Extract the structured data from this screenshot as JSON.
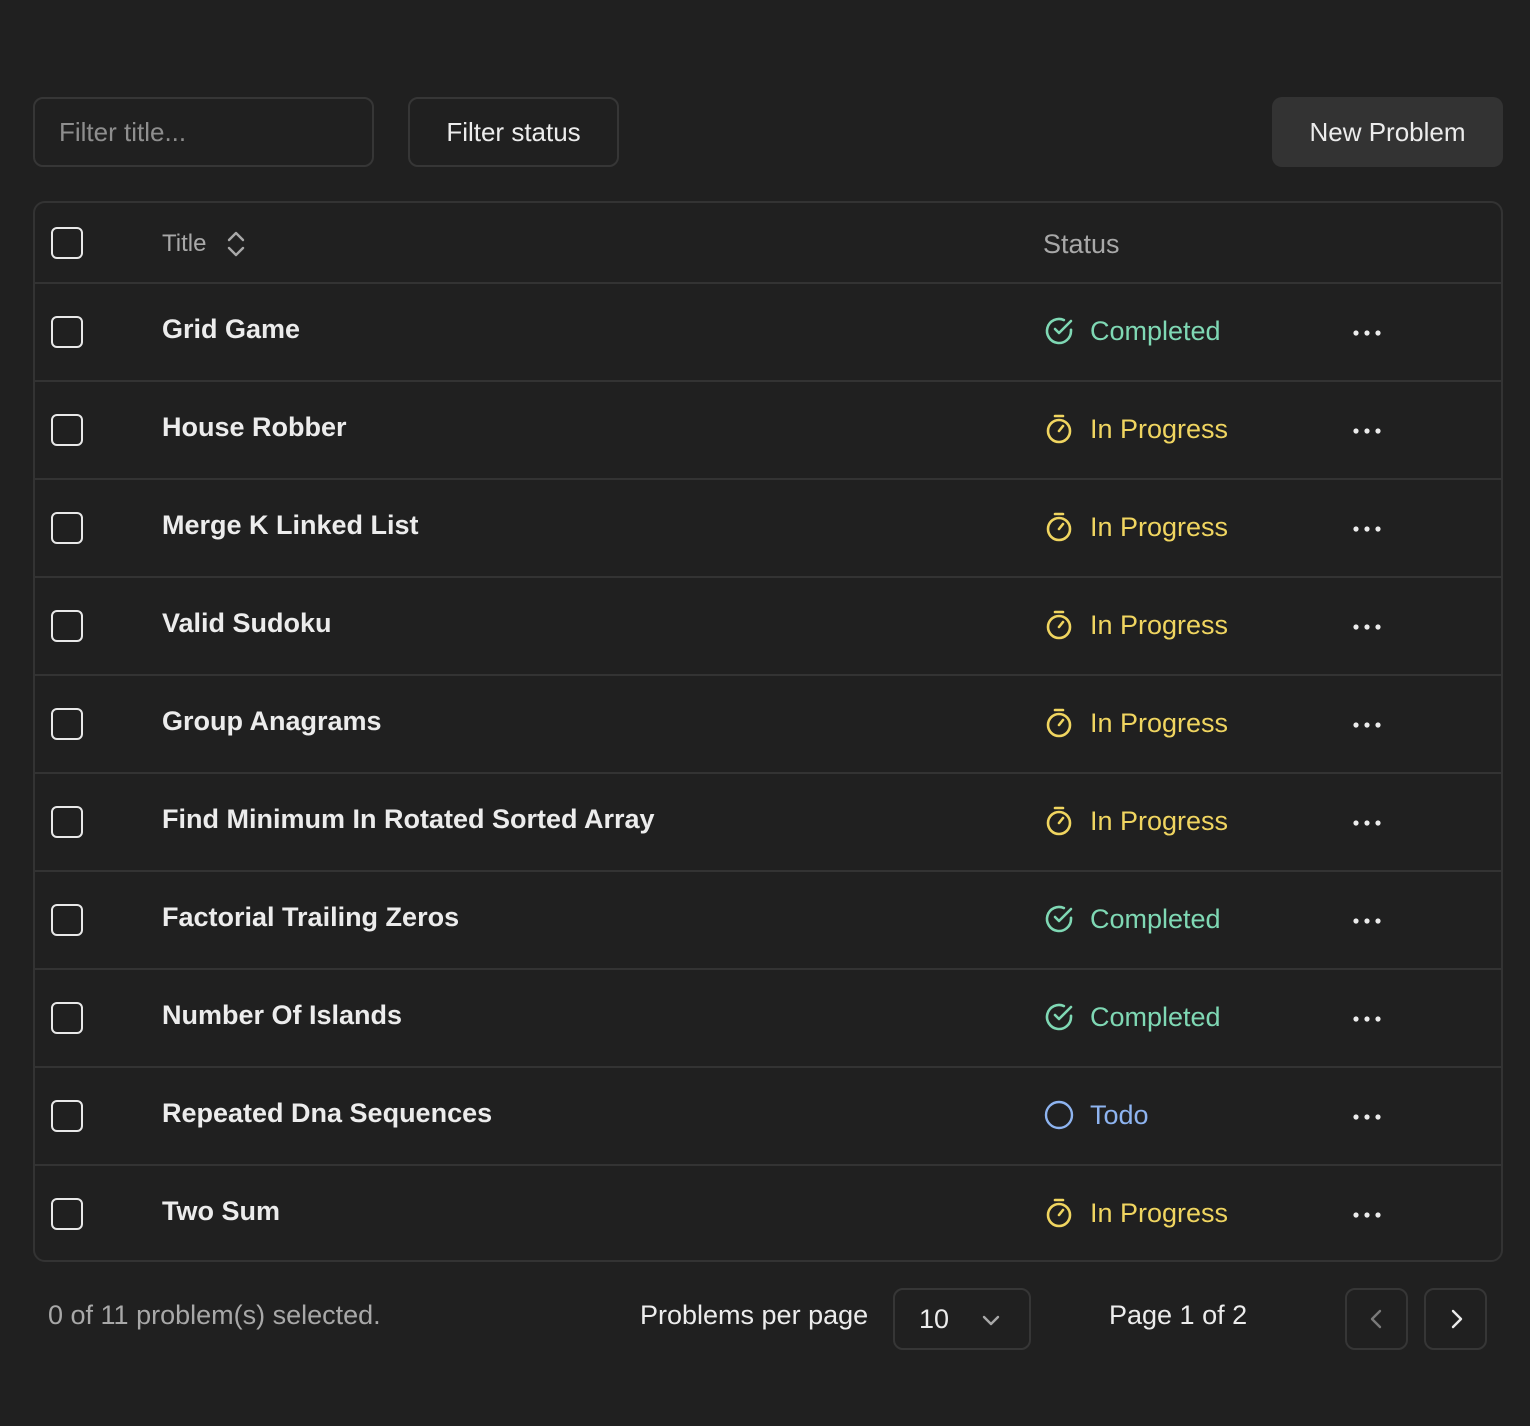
{
  "toolbar": {
    "filter_placeholder": "Filter title...",
    "filter_value": "",
    "filter_status_label": "Filter status",
    "new_problem_label": "New Problem"
  },
  "table": {
    "columns": {
      "title": "Title",
      "status": "Status"
    },
    "rows": [
      {
        "title": "Grid Game",
        "status": "Completed",
        "status_kind": "completed",
        "selected": false
      },
      {
        "title": "House Robber",
        "status": "In Progress",
        "status_kind": "in-progress",
        "selected": false
      },
      {
        "title": "Merge K Linked List",
        "status": "In Progress",
        "status_kind": "in-progress",
        "selected": false
      },
      {
        "title": "Valid Sudoku",
        "status": "In Progress",
        "status_kind": "in-progress",
        "selected": false
      },
      {
        "title": "Group Anagrams",
        "status": "In Progress",
        "status_kind": "in-progress",
        "selected": false
      },
      {
        "title": "Find Minimum In Rotated Sorted Array",
        "status": "In Progress",
        "status_kind": "in-progress",
        "selected": false
      },
      {
        "title": "Factorial Trailing Zeros",
        "status": "Completed",
        "status_kind": "completed",
        "selected": false
      },
      {
        "title": "Number Of Islands",
        "status": "Completed",
        "status_kind": "completed",
        "selected": false
      },
      {
        "title": "Repeated Dna Sequences",
        "status": "Todo",
        "status_kind": "todo",
        "selected": false
      },
      {
        "title": "Two Sum",
        "status": "In Progress",
        "status_kind": "in-progress",
        "selected": false
      }
    ]
  },
  "footer": {
    "selected_text": "0 of 11 problem(s) selected.",
    "per_page_label": "Problems per page",
    "per_page_value": "10",
    "page_indicator": "Page 1 of 2"
  },
  "icons": {
    "sort": "chevron-up-down-icon",
    "completed": "check-circle-icon",
    "in-progress": "stopwatch-icon",
    "todo": "circle-icon",
    "more": "more-horizontal-icon",
    "dropdown": "chevron-down-icon",
    "prev": "chevron-left-icon",
    "next": "chevron-right-icon"
  },
  "colors": {
    "background": "#202020",
    "border": "#333333",
    "completed": "#7fd8b4",
    "in-progress": "#f0d560",
    "todo": "#8eb4f0",
    "primary_button_bg": "#333333"
  }
}
